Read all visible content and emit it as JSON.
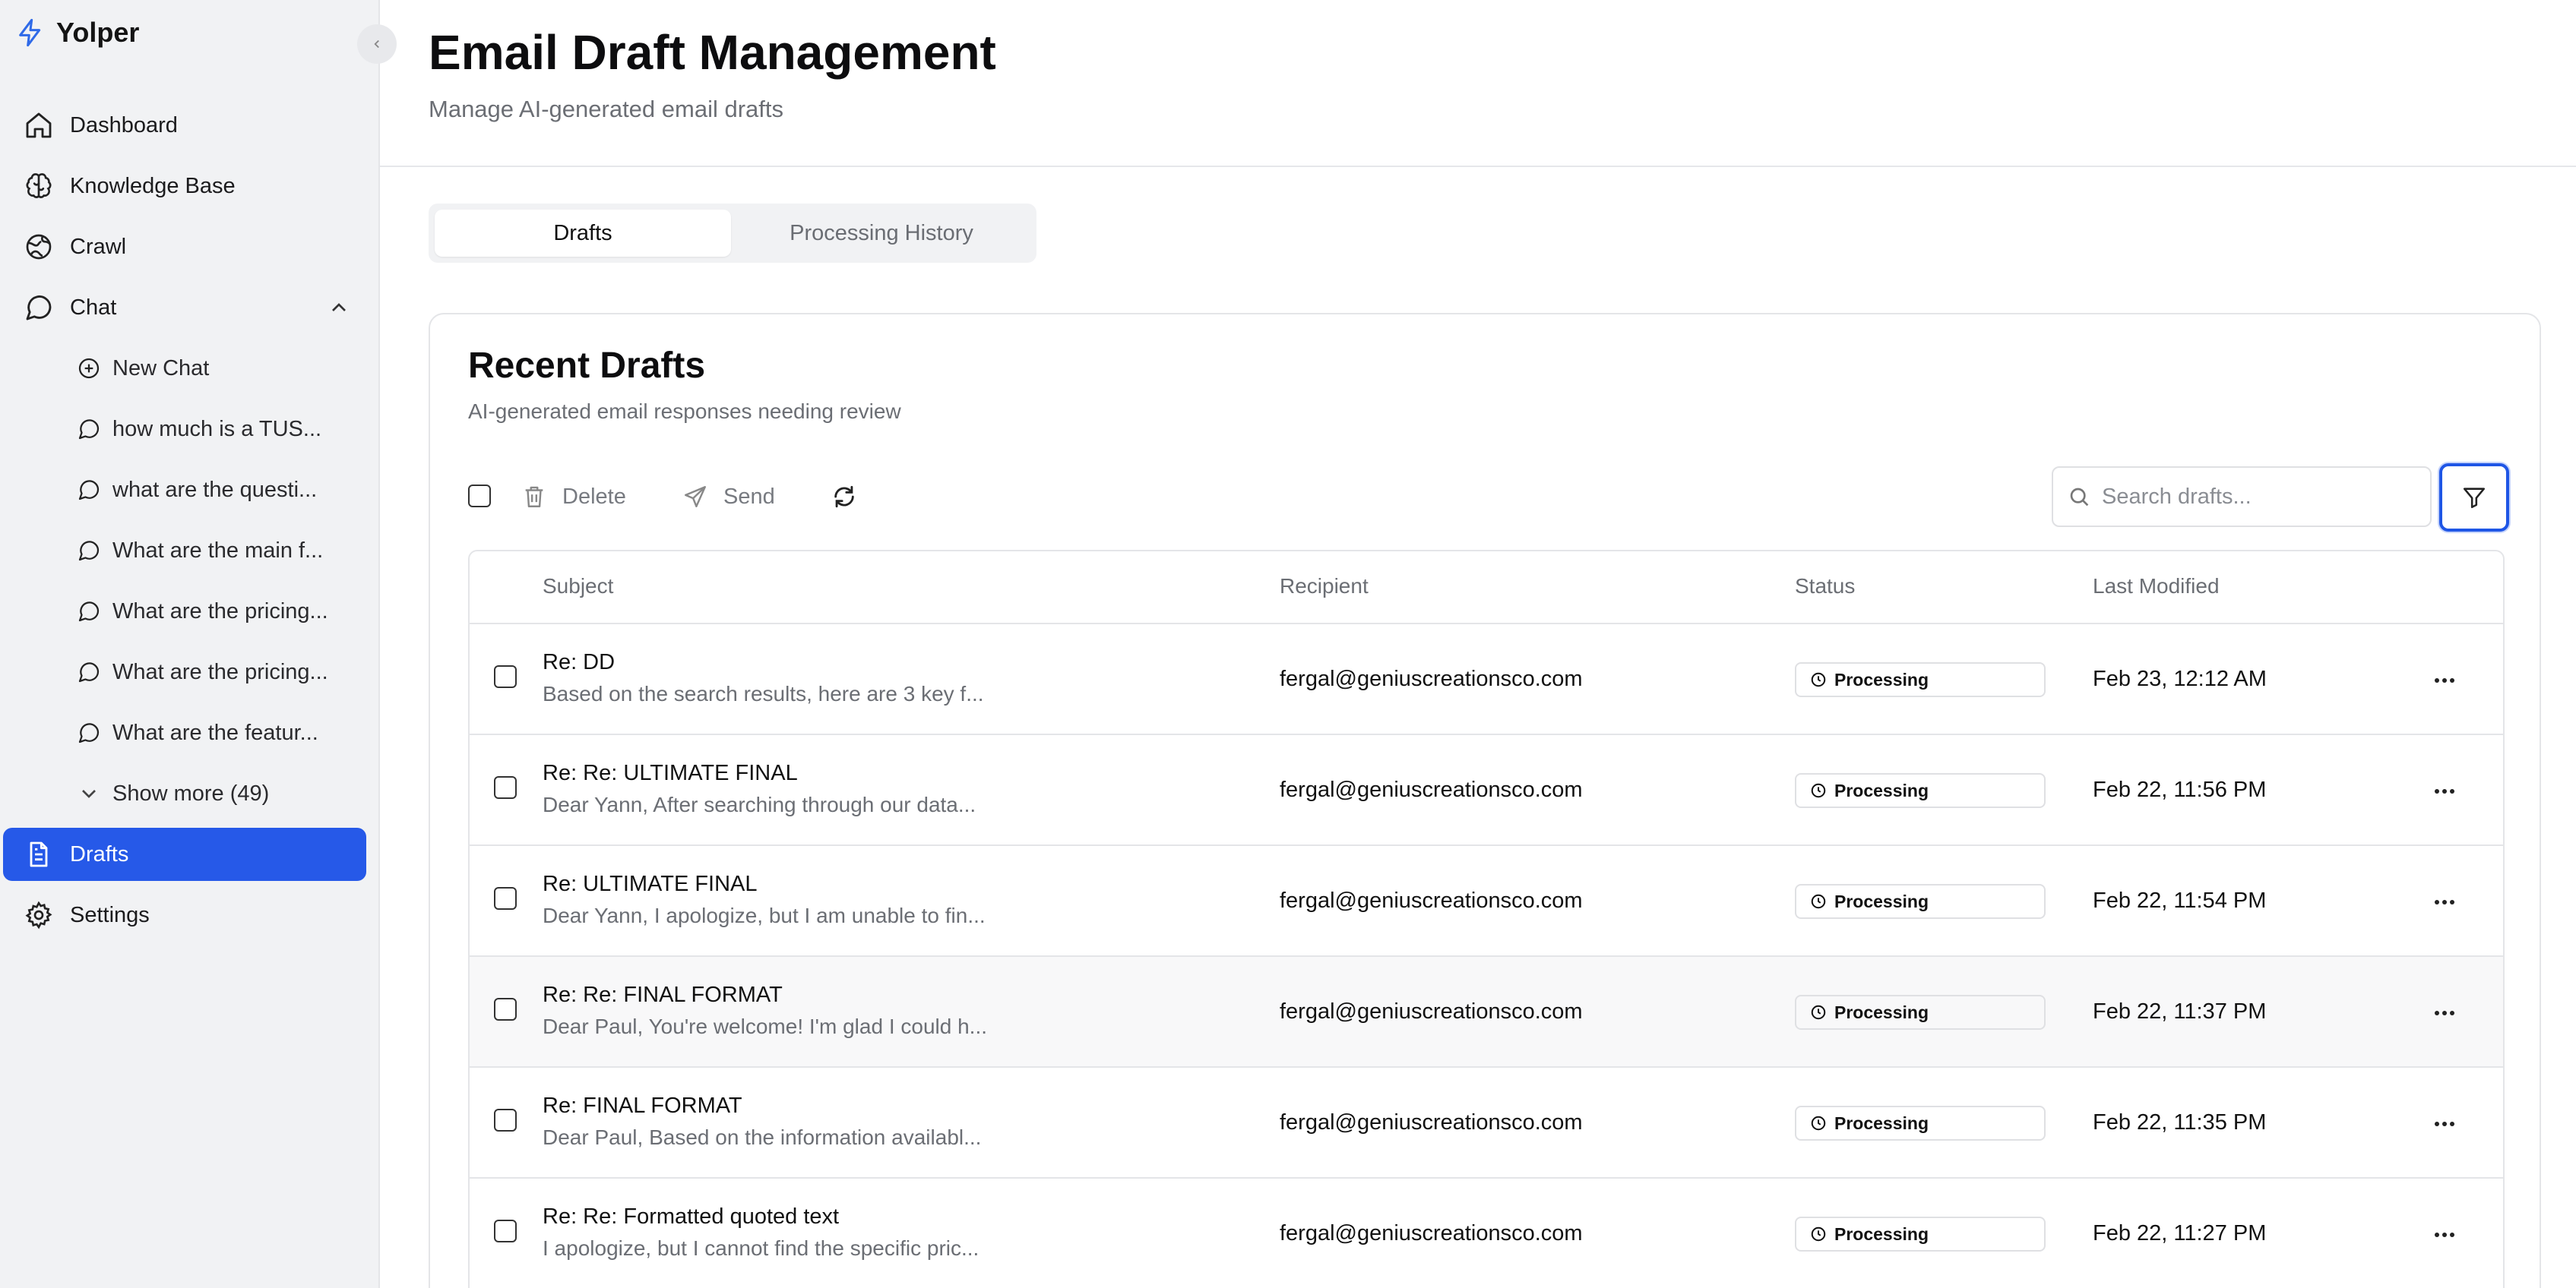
{
  "app": {
    "name": "Yolper",
    "accent": "#2659e8"
  },
  "sidebar": {
    "collapse_icon": "chevron-left-icon",
    "items": [
      {
        "label": "Dashboard",
        "icon": "home-icon"
      },
      {
        "label": "Knowledge Base",
        "icon": "brain-icon"
      },
      {
        "label": "Crawl",
        "icon": "globe-icon"
      },
      {
        "label": "Chat",
        "icon": "message-circle-icon",
        "expanded": true
      },
      {
        "label": "New Chat",
        "icon": "plus-circle-icon"
      },
      {
        "label": "how much is a TUS...",
        "icon": "message-circle-icon"
      },
      {
        "label": "what are the questi...",
        "icon": "message-circle-icon"
      },
      {
        "label": "What are the main f...",
        "icon": "message-circle-icon"
      },
      {
        "label": "What are the pricing...",
        "icon": "message-circle-icon"
      },
      {
        "label": "What are the pricing...",
        "icon": "message-circle-icon"
      },
      {
        "label": "What are the featur...",
        "icon": "message-circle-icon"
      },
      {
        "label": "Show more (49)",
        "icon": "chevron-down-icon"
      },
      {
        "label": "Drafts",
        "icon": "file-text-icon",
        "active": true
      },
      {
        "label": "Settings",
        "icon": "gear-icon"
      }
    ]
  },
  "header": {
    "title": "Email Draft Management",
    "subtitle": "Manage AI-generated email drafts"
  },
  "tabs": [
    {
      "label": "Drafts",
      "selected": true
    },
    {
      "label": "Processing History",
      "selected": false
    }
  ],
  "card": {
    "title": "Recent Drafts",
    "subtitle": "AI-generated email responses needing review"
  },
  "toolbar": {
    "delete_label": "Delete",
    "send_label": "Send",
    "search_placeholder": "Search drafts..."
  },
  "table": {
    "columns": [
      "Subject",
      "Recipient",
      "Status",
      "Last Modified"
    ],
    "rows": [
      {
        "subject": "Re: DD",
        "preview": "Based on the search results, here are 3 key f...",
        "recipient": "fergal@geniuscreationsco.com",
        "status": "Processing",
        "modified": "Feb 23, 12:12 AM"
      },
      {
        "subject": "Re: Re: ULTIMATE FINAL",
        "preview": "Dear Yann, After searching through our data...",
        "recipient": "fergal@geniuscreationsco.com",
        "status": "Processing",
        "modified": "Feb 22, 11:56 PM"
      },
      {
        "subject": "Re: ULTIMATE FINAL",
        "preview": "Dear Yann, I apologize, but I am unable to fin...",
        "recipient": "fergal@geniuscreationsco.com",
        "status": "Processing",
        "modified": "Feb 22, 11:54 PM"
      },
      {
        "subject": "Re: Re: FINAL FORMAT",
        "preview": "Dear Paul, You're welcome! I'm glad I could h...",
        "recipient": "fergal@geniuscreationsco.com",
        "status": "Processing",
        "modified": "Feb 22, 11:37 PM"
      },
      {
        "subject": "Re: FINAL FORMAT",
        "preview": "Dear Paul, Based on the information availabl...",
        "recipient": "fergal@geniuscreationsco.com",
        "status": "Processing",
        "modified": "Feb 22, 11:35 PM"
      },
      {
        "subject": "Re: Re: Formatted quoted text",
        "preview": "I apologize, but I cannot find the specific pric...",
        "recipient": "fergal@geniuscreationsco.com",
        "status": "Processing",
        "modified": "Feb 22, 11:27 PM"
      }
    ]
  }
}
